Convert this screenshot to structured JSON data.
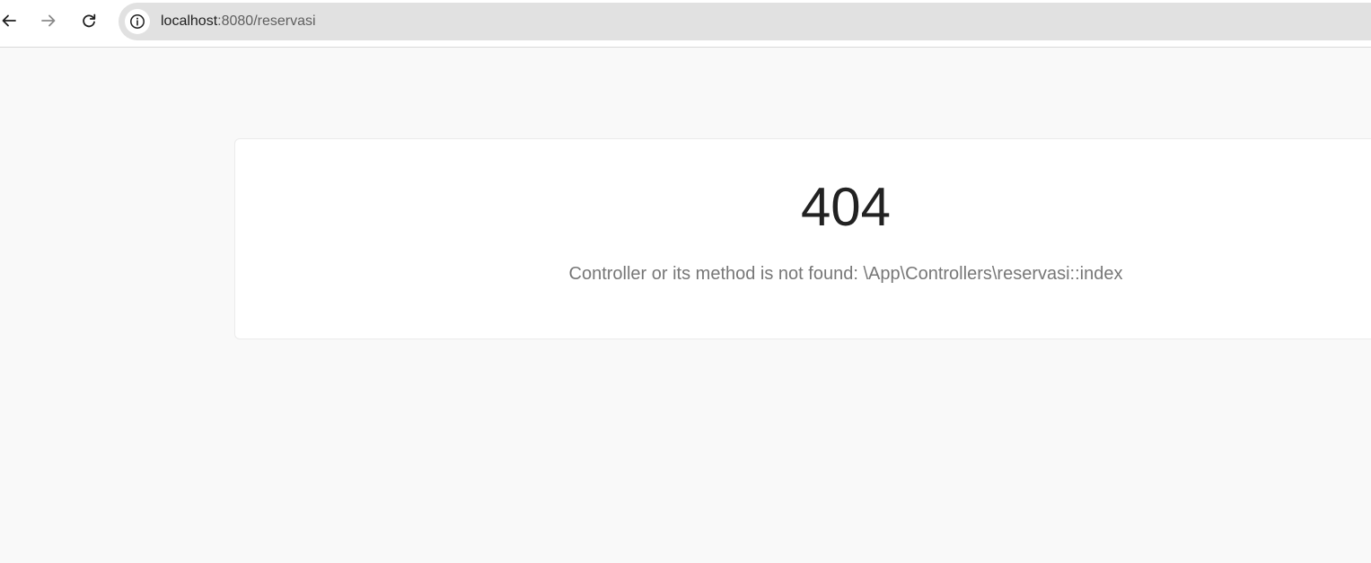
{
  "browser": {
    "back_icon": "arrow-left-icon",
    "forward_icon": "arrow-right-icon",
    "reload_icon": "reload-icon",
    "site_info_icon": "info-icon",
    "url_host": "localhost",
    "url_path": ":8080/reservasi"
  },
  "error": {
    "code": "404",
    "message": "Controller or its method is not found: \\App\\Controllers\\reservasi::index"
  },
  "colors": {
    "page_background": "#f9f9f9",
    "card_background": "#ffffff",
    "omnibox_background": "#e1e1e1",
    "code_text": "#222222",
    "message_text": "#777777"
  }
}
